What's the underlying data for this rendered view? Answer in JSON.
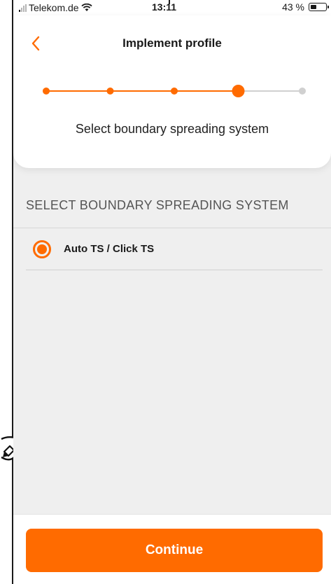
{
  "status_bar": {
    "carrier": "Telekom.de",
    "time": "13:11",
    "battery_percent": "43 %",
    "battery_level": 0.43,
    "signal_bars_active": 1,
    "signal_bars_total": 4,
    "icons": [
      "signal-icon",
      "wifi-icon",
      "battery-icon"
    ]
  },
  "header": {
    "title": "Implement profile",
    "back_icon": "chevron-left-icon",
    "stepper": {
      "total_steps": 5,
      "current_step": 4,
      "active_color": "#ff6b00",
      "inactive_color": "#d0d0d0"
    },
    "subtitle": "Select boundary spreading system"
  },
  "section": {
    "heading": "SELECT BOUNDARY SPREADING SYSTEM",
    "options": [
      {
        "label": "Auto TS / Click TS",
        "selected": true
      }
    ]
  },
  "footer": {
    "continue_label": "Continue"
  },
  "colors": {
    "accent": "#ff6b00",
    "background": "#efefef",
    "card": "#ffffff"
  },
  "overlay": {
    "icon": "pen-icon"
  }
}
